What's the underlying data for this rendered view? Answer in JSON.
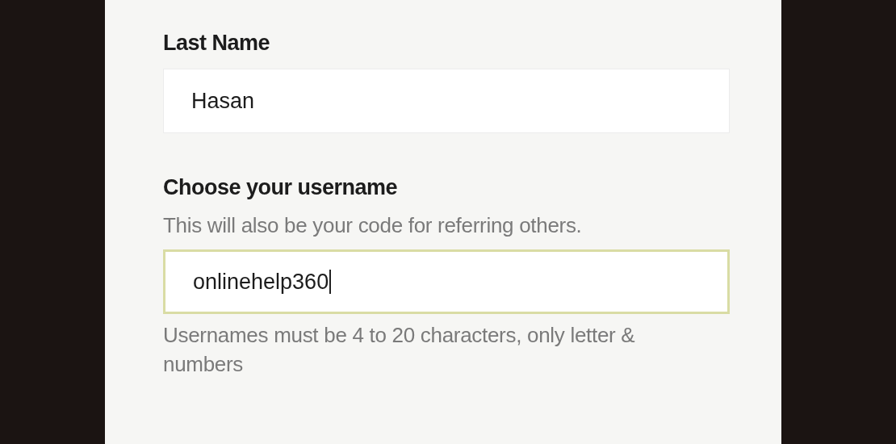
{
  "fields": [
    {
      "label": "Last Name",
      "value": "Hasan",
      "focused": false
    },
    {
      "label": "Choose your username",
      "hint": "This will also be your code for referring others.",
      "value": "onlinehelp360",
      "focused": true,
      "helper": "Usernames must be 4 to 20 characters, only letter & numbers"
    }
  ]
}
